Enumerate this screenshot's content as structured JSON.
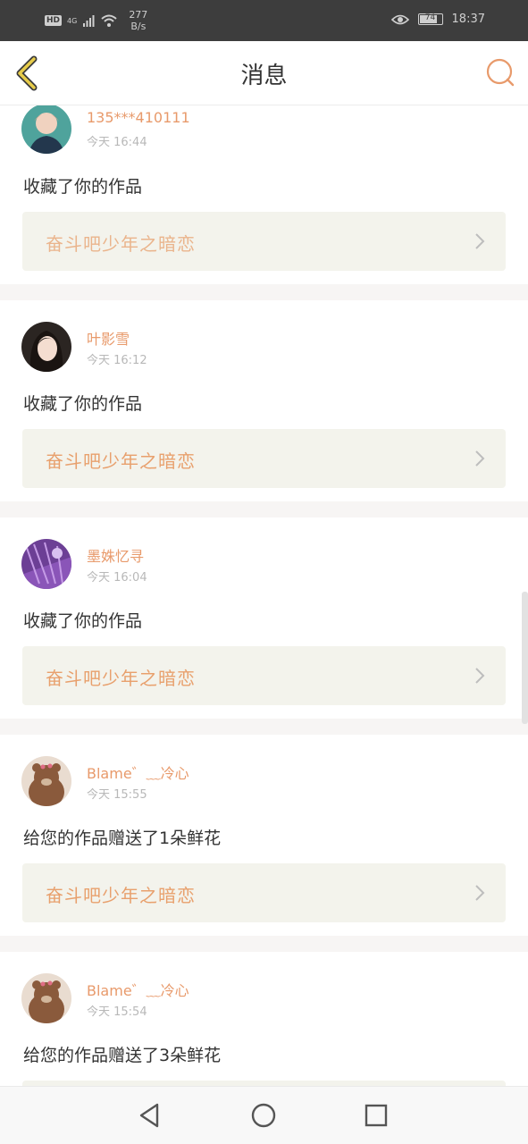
{
  "status_bar": {
    "hd": "HD",
    "network": "4G",
    "speed_value": "277",
    "speed_unit": "B/s",
    "battery": "74",
    "time": "18:37"
  },
  "header": {
    "title": "消息"
  },
  "colors": {
    "accent": "#e89a6b",
    "back": "#d8b437",
    "card_bg": "#f3f3ec"
  },
  "messages": [
    {
      "user": "135***410111",
      "time": "今天 16:44",
      "action": "收藏了你的作品",
      "work": "奋斗吧少年之暗恋",
      "avatar": "avatar-boy"
    },
    {
      "user": "叶影雪",
      "time": "今天 16:12",
      "action": "收藏了你的作品",
      "work": "奋斗吧少年之暗恋",
      "avatar": "avatar-girl"
    },
    {
      "user": "墨姝忆寻",
      "time": "今天 16:04",
      "action": "收藏了你的作品",
      "work": "奋斗吧少年之暗恋",
      "avatar": "avatar-lavender"
    },
    {
      "user": "Blame゛﹏冷心",
      "time": "今天 15:55",
      "action": "给您的作品赠送了1朵鲜花",
      "work": "奋斗吧少年之暗恋",
      "avatar": "avatar-bear"
    },
    {
      "user": "Blame゛﹏冷心",
      "time": "今天 15:54",
      "action": "给您的作品赠送了3朵鲜花",
      "work": "",
      "avatar": "avatar-bear"
    }
  ]
}
